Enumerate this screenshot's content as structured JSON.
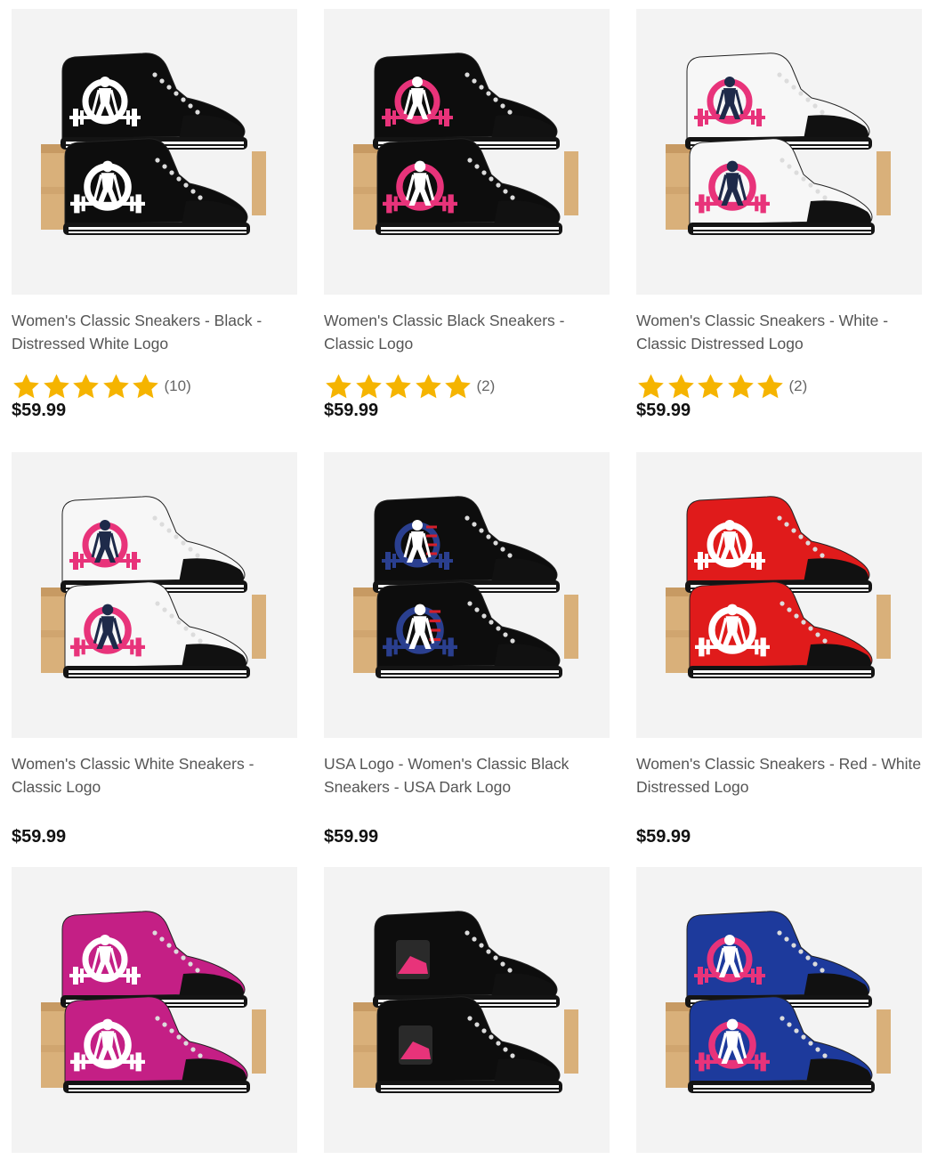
{
  "colors": {
    "star": "#F5B400",
    "box": "#D9B07A",
    "box_dark": "#C79A63",
    "sole": "#1a1a1a"
  },
  "products": [
    {
      "title_line1": "Women's Classic Sneakers - Black -",
      "title_line2": "Distressed White Logo",
      "price": "$59.99",
      "stars": 5,
      "review_count": "(10)",
      "shoe_color": "#0d0d0d",
      "logo_color": "#ffffff",
      "figure_color": "#ffffff",
      "icon": "black-white-logo-sneakers-image"
    },
    {
      "title_line1": "Women's Classic Black Sneakers -",
      "title_line2": "Classic Logo",
      "price": "$59.99",
      "stars": 5,
      "review_count": "(2)",
      "shoe_color": "#0d0d0d",
      "logo_color": "#e8337a",
      "figure_color": "#ffffff",
      "icon": "black-pink-logo-sneakers-image"
    },
    {
      "title_line1": "Women's Classic Sneakers - White -",
      "title_line2": "Classic Distressed Logo",
      "price": "$59.99",
      "stars": 5,
      "review_count": "(2)",
      "shoe_color": "#f7f7f7",
      "logo_color": "#e8337a",
      "figure_color": "#1e2a4a",
      "icon": "white-pink-distressed-sneakers-image"
    },
    {
      "title_line1": "Women's Classic White Sneakers -",
      "title_line2": "Classic Logo",
      "price": "$59.99",
      "stars": 0,
      "review_count": "",
      "shoe_color": "#f7f7f7",
      "logo_color": "#e8337a",
      "figure_color": "#1e2a4a",
      "icon": "white-classic-logo-sneakers-image"
    },
    {
      "title_line1": "USA Logo - Women's Classic Black",
      "title_line2": "Sneakers - USA Dark Logo",
      "price": "$59.99",
      "stars": 0,
      "review_count": "",
      "shoe_color": "#0d0d0d",
      "logo_color": "#2a3f8f",
      "figure_color": "#ffffff",
      "icon": "black-usa-logo-sneakers-image"
    },
    {
      "title_line1": "Women's Classic Sneakers - Red - White",
      "title_line2": "Distressed Logo",
      "price": "$59.99",
      "stars": 0,
      "review_count": "",
      "shoe_color": "#e01b1b",
      "logo_color": "#ffffff",
      "figure_color": "#ffffff",
      "icon": "red-white-logo-sneakers-image"
    },
    {
      "title_line1": "",
      "title_line2": "",
      "price": "",
      "stars": 0,
      "review_count": "",
      "shoe_color": "#c41f85",
      "logo_color": "#ffffff",
      "figure_color": "#ffffff",
      "icon": "magenta-white-logo-sneakers-image"
    },
    {
      "title_line1": "",
      "title_line2": "",
      "price": "",
      "stars": 0,
      "review_count": "",
      "shoe_color": "#0d0d0d",
      "logo_color": "#e8337a",
      "figure_color": "#e8337a",
      "icon": "black-strong-beautiful-sneakers-image"
    },
    {
      "title_line1": "",
      "title_line2": "",
      "price": "",
      "stars": 0,
      "review_count": "",
      "shoe_color": "#1d3a9c",
      "logo_color": "#e8337a",
      "figure_color": "#ffffff",
      "icon": "blue-pink-logo-sneakers-image"
    }
  ]
}
